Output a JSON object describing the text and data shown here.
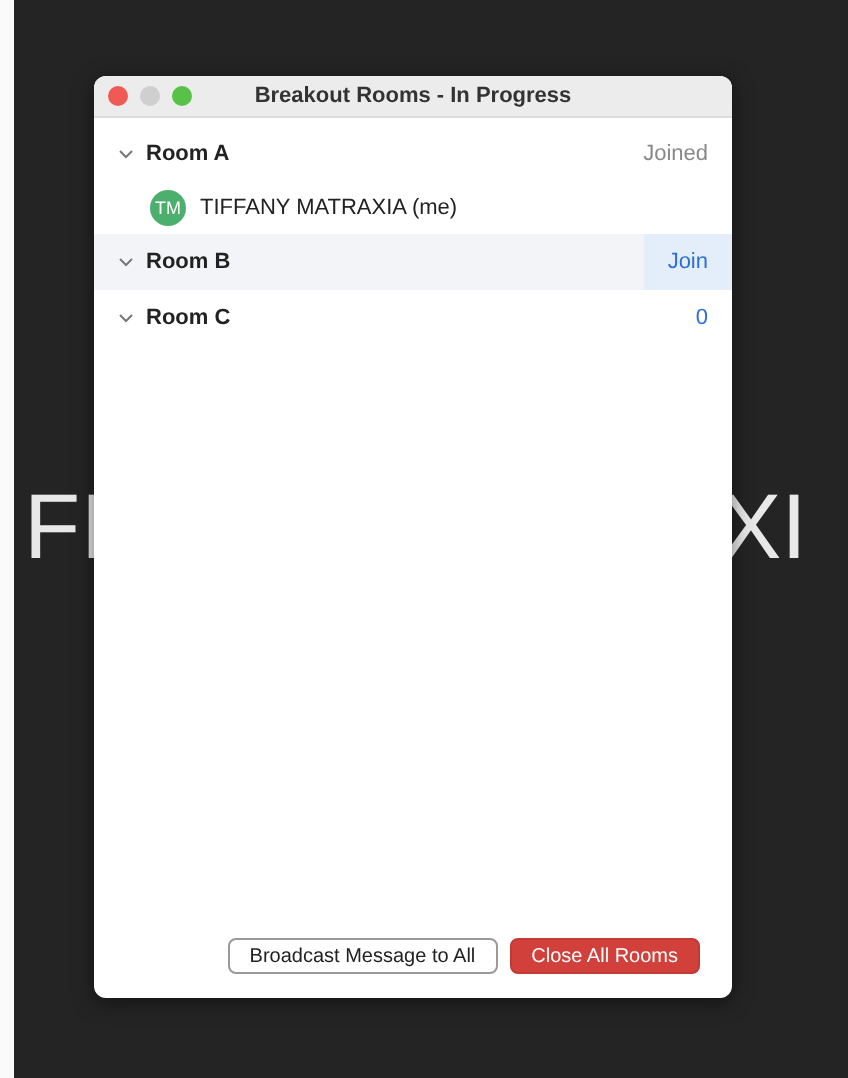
{
  "background_video": {
    "name_left": "FI",
    "name_right": "XI"
  },
  "window": {
    "title": "Breakout Rooms - In Progress"
  },
  "rooms": [
    {
      "name": "Room A",
      "expanded": true,
      "selected": false,
      "kind": "label",
      "status": "Joined",
      "members": [
        {
          "initials": "TM",
          "name": "TIFFANY MATRAXIA (me)",
          "color": "#4caf6e"
        }
      ]
    },
    {
      "name": "Room B",
      "expanded": true,
      "selected": true,
      "kind": "button",
      "status": "Join"
    },
    {
      "name": "Room C",
      "expanded": true,
      "selected": false,
      "kind": "count",
      "status": "0"
    }
  ],
  "buttons": [
    {
      "label": "Broadcast Message to All",
      "kind": "secondary"
    },
    {
      "label": "Close All Rooms",
      "kind": "danger"
    }
  ]
}
